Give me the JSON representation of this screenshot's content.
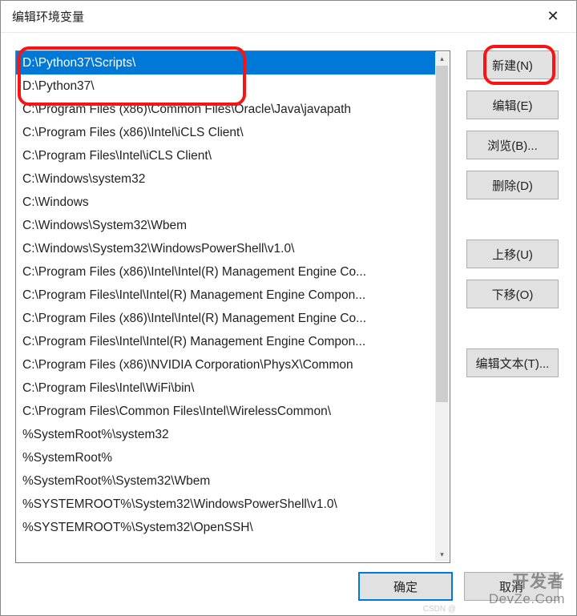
{
  "window": {
    "title": "编辑环境变量"
  },
  "list": {
    "items": [
      {
        "text": "D:\\Python37\\Scripts\\",
        "selected": true
      },
      {
        "text": "D:\\Python37\\",
        "selected": false
      },
      {
        "text": "C:\\Program Files (x86)\\Common Files\\Oracle\\Java\\javapath",
        "selected": false
      },
      {
        "text": "C:\\Program Files (x86)\\Intel\\iCLS Client\\",
        "selected": false
      },
      {
        "text": "C:\\Program Files\\Intel\\iCLS Client\\",
        "selected": false
      },
      {
        "text": "C:\\Windows\\system32",
        "selected": false
      },
      {
        "text": "C:\\Windows",
        "selected": false
      },
      {
        "text": "C:\\Windows\\System32\\Wbem",
        "selected": false
      },
      {
        "text": "C:\\Windows\\System32\\WindowsPowerShell\\v1.0\\",
        "selected": false
      },
      {
        "text": "C:\\Program Files (x86)\\Intel\\Intel(R) Management Engine Co...",
        "selected": false
      },
      {
        "text": "C:\\Program Files\\Intel\\Intel(R) Management Engine Compon...",
        "selected": false
      },
      {
        "text": "C:\\Program Files (x86)\\Intel\\Intel(R) Management Engine Co...",
        "selected": false
      },
      {
        "text": "C:\\Program Files\\Intel\\Intel(R) Management Engine Compon...",
        "selected": false
      },
      {
        "text": "C:\\Program Files (x86)\\NVIDIA Corporation\\PhysX\\Common",
        "selected": false
      },
      {
        "text": "C:\\Program Files\\Intel\\WiFi\\bin\\",
        "selected": false
      },
      {
        "text": "C:\\Program Files\\Common Files\\Intel\\WirelessCommon\\",
        "selected": false
      },
      {
        "text": "%SystemRoot%\\system32",
        "selected": false
      },
      {
        "text": "%SystemRoot%",
        "selected": false
      },
      {
        "text": "%SystemRoot%\\System32\\Wbem",
        "selected": false
      },
      {
        "text": "%SYSTEMROOT%\\System32\\WindowsPowerShell\\v1.0\\",
        "selected": false
      },
      {
        "text": "%SYSTEMROOT%\\System32\\OpenSSH\\",
        "selected": false
      }
    ]
  },
  "buttons": {
    "new": "新建(N)",
    "edit": "编辑(E)",
    "browse": "浏览(B)...",
    "delete": "删除(D)",
    "moveUp": "上移(U)",
    "moveDown": "下移(O)",
    "editText": "编辑文本(T)..."
  },
  "footer": {
    "ok": "确定",
    "cancel": "取消"
  },
  "watermark": {
    "line1": "开发者",
    "line2": "DevZe.Com",
    "small": "CSDN @"
  }
}
